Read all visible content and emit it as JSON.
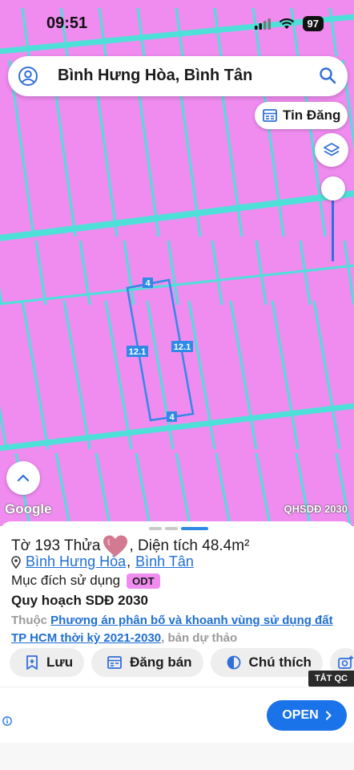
{
  "status_bar": {
    "time": "09:51",
    "battery": "97"
  },
  "search": {
    "text": "Bình Hưng Hòa, Bình Tân"
  },
  "map": {
    "news_button_label": "Tin Đăng",
    "attribution": "Google",
    "layer_label": "QHSDĐ 2030",
    "parcel_dimensions": {
      "top": "4",
      "bottom": "4",
      "left": "12.1",
      "right": "12.1"
    },
    "colors": {
      "land": "#f08cf0",
      "roads": "#4ee0d8",
      "parcel_outline": "#2f8ae6"
    }
  },
  "sheet": {
    "title_prefix": "Tờ 193 Thửa",
    "title_suffix": ", Diện tích 48.4m²",
    "ward_link": "Bình Hưng Hòa",
    "separator": ",",
    "district_link": "Bình Tân",
    "purpose_label": "Mục đích sử dụng",
    "purpose_code": "ODT",
    "plan_title": "Quy hoạch SDĐ 2030",
    "plan_prefix": "Thuộc",
    "plan_link": "Phương án phân bố và khoanh vùng sử dụng đất TP HCM thời kỳ 2021-2030",
    "plan_suffix": ", bản dự thảo",
    "actions": {
      "save": "Lưu",
      "sell": "Đăng bán",
      "legend": "Chú thích"
    }
  },
  "ad": {
    "close_label": "TẮT QC",
    "open_label": "OPEN"
  }
}
